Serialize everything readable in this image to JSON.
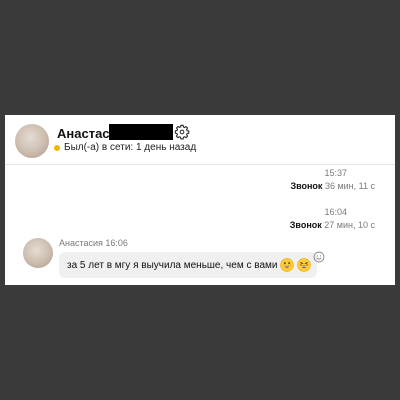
{
  "header": {
    "name": "Анастасия",
    "status": "Был(-а) в сети: 1 день назад",
    "status_color": "#f4b400"
  },
  "calls": [
    {
      "time": "15:37",
      "label": "Звонок",
      "duration": "36 мин, 11 с"
    },
    {
      "time": "16:04",
      "label": "Звонок",
      "duration": "27 мин, 10 с"
    }
  ],
  "message": {
    "meta": "Анастасия 16:06",
    "text": "за 5 лет в мгу я выучила меньше, чем с вами",
    "emojis": [
      "grinning-face-icon",
      "grinning-squinting-face-icon"
    ]
  },
  "icons": {
    "settings": "gear-icon",
    "reaction": "smiley-reaction-icon"
  }
}
